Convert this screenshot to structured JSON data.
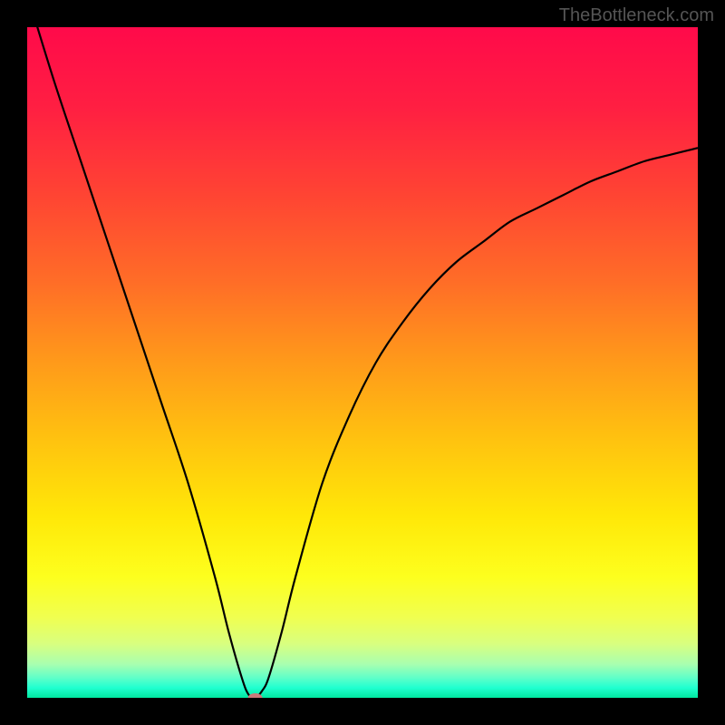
{
  "watermark": "TheBottleneck.com",
  "chart_data": {
    "type": "line",
    "title": "",
    "xlabel": "",
    "ylabel": "",
    "xlim": [
      0,
      100
    ],
    "ylim": [
      0,
      100
    ],
    "series": [
      {
        "name": "bottleneck-curve",
        "x": [
          0,
          4,
          8,
          12,
          16,
          20,
          24,
          28,
          30,
          32,
          33,
          34,
          35,
          36,
          38,
          40,
          44,
          48,
          52,
          56,
          60,
          64,
          68,
          72,
          76,
          80,
          84,
          88,
          92,
          96,
          100
        ],
        "y": [
          105,
          92,
          80,
          68,
          56,
          44,
          32,
          18,
          10,
          3,
          0.5,
          0,
          1,
          3,
          10,
          18,
          32,
          42,
          50,
          56,
          61,
          65,
          68,
          71,
          73,
          75,
          77,
          78.5,
          80,
          81,
          82
        ]
      }
    ],
    "marker": {
      "x": 34,
      "y": 0,
      "color": "#c97a7a"
    },
    "gradient": {
      "stops": [
        {
          "offset": 0,
          "color": "#ff0a4a"
        },
        {
          "offset": 0.12,
          "color": "#ff1f42"
        },
        {
          "offset": 0.25,
          "color": "#ff4433"
        },
        {
          "offset": 0.38,
          "color": "#ff6d27"
        },
        {
          "offset": 0.5,
          "color": "#ff9a1a"
        },
        {
          "offset": 0.62,
          "color": "#ffc40f"
        },
        {
          "offset": 0.73,
          "color": "#ffe808"
        },
        {
          "offset": 0.82,
          "color": "#fdff1e"
        },
        {
          "offset": 0.88,
          "color": "#f0ff50"
        },
        {
          "offset": 0.92,
          "color": "#d8ff80"
        },
        {
          "offset": 0.95,
          "color": "#a8ffb0"
        },
        {
          "offset": 0.97,
          "color": "#60ffc8"
        },
        {
          "offset": 0.985,
          "color": "#20ffd0"
        },
        {
          "offset": 1.0,
          "color": "#00e8a0"
        }
      ]
    }
  }
}
